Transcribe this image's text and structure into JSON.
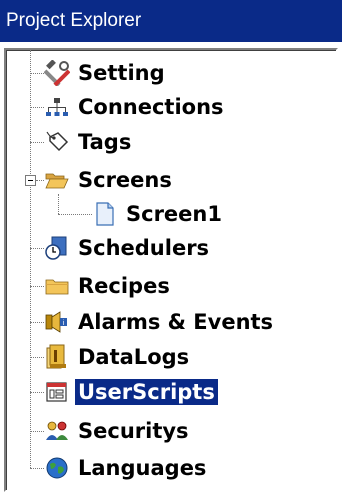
{
  "window": {
    "title": "Project Explorer"
  },
  "tree": {
    "items": [
      {
        "label": "Setting",
        "icon": "tools-icon",
        "selected": false
      },
      {
        "label": "Connections",
        "icon": "network-icon",
        "selected": false
      },
      {
        "label": "Tags",
        "icon": "tag-icon",
        "selected": false
      },
      {
        "label": "Screens",
        "icon": "open-folder-icon",
        "selected": false,
        "expanded": true,
        "children": [
          {
            "label": "Screen1",
            "icon": "document-icon",
            "selected": false
          }
        ]
      },
      {
        "label": "Schedulers",
        "icon": "scheduler-clock-icon",
        "selected": false
      },
      {
        "label": "Recipes",
        "icon": "folder-icon",
        "selected": false
      },
      {
        "label": "Alarms & Events",
        "icon": "alarm-icon",
        "selected": false
      },
      {
        "label": "DataLogs",
        "icon": "datalog-icon",
        "selected": false
      },
      {
        "label": "UserScripts",
        "icon": "script-icon",
        "selected": true
      },
      {
        "label": "Securitys",
        "icon": "users-icon",
        "selected": false
      },
      {
        "label": "Languages",
        "icon": "globe-icon",
        "selected": false
      }
    ]
  },
  "colors": {
    "title_bar": "#0a2a88",
    "selection": "#0a2a88"
  }
}
